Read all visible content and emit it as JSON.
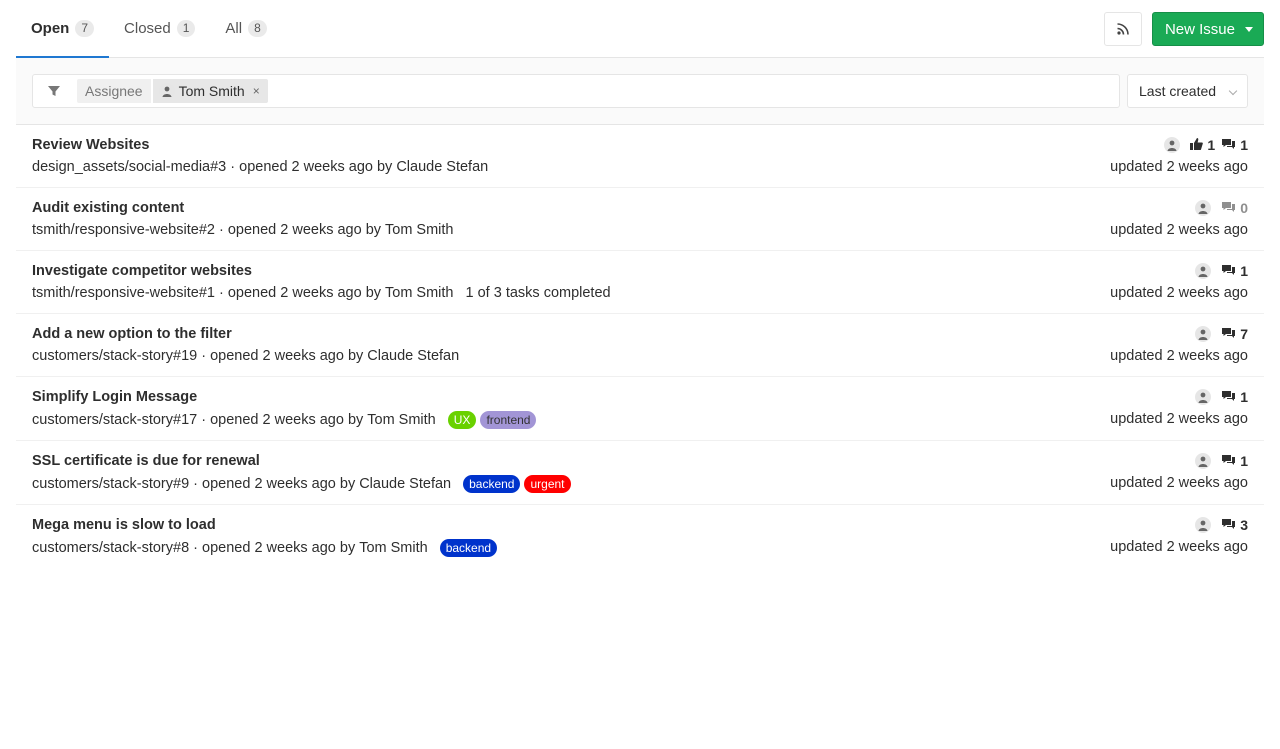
{
  "tabs": [
    {
      "label": "Open",
      "count": "7"
    },
    {
      "label": "Closed",
      "count": "1"
    },
    {
      "label": "All",
      "count": "8"
    }
  ],
  "actions": {
    "rss_icon": "rss-icon",
    "new_issue_label": "New Issue"
  },
  "filter": {
    "token_name": "Assignee",
    "token_value": "Tom Smith",
    "token_remove": "×"
  },
  "sort": {
    "selected": "Last created"
  },
  "colors": {
    "primary_green": "#1aaa55",
    "active_tab": "#1f78d1",
    "label_ux": "#69d100",
    "label_frontend": "#a295d6",
    "label_backend": "#0033cc",
    "label_urgent": "#ff0000"
  },
  "issues": [
    {
      "title": "Review Websites",
      "ref": "design_assets/social-media#3",
      "opened": " · opened 2 weeks ago by",
      "author": "Claude Stefan",
      "tasks": "",
      "labels": [],
      "thumbs_up": "1",
      "comments": "1",
      "updated": "updated 2 weeks ago"
    },
    {
      "title": "Audit existing content",
      "ref": "tsmith/responsive-website#2",
      "opened": " · opened 2 weeks ago by",
      "author": "Tom Smith",
      "tasks": "",
      "labels": [],
      "thumbs_up": "",
      "comments": "0",
      "updated": "updated 2 weeks ago"
    },
    {
      "title": "Investigate competitor websites",
      "ref": "tsmith/responsive-website#1",
      "opened": " · opened 2 weeks ago by",
      "author": "Tom Smith",
      "tasks": "1 of 3 tasks completed",
      "labels": [],
      "thumbs_up": "",
      "comments": "1",
      "updated": "updated 2 weeks ago"
    },
    {
      "title": "Add a new option to the filter",
      "ref": "customers/stack-story#19",
      "opened": " · opened 2 weeks ago by",
      "author": "Claude Stefan",
      "tasks": "",
      "labels": [],
      "thumbs_up": "",
      "comments": "7",
      "updated": "updated 2 weeks ago"
    },
    {
      "title": "Simplify Login Message",
      "ref": "customers/stack-story#17",
      "opened": " · opened 2 weeks ago by",
      "author": "Tom Smith",
      "tasks": "",
      "labels": [
        {
          "text": "UX",
          "color": "#69d100"
        },
        {
          "text": "frontend",
          "color": "#a295d6",
          "text_color": "#333333"
        }
      ],
      "thumbs_up": "",
      "comments": "1",
      "updated": "updated 2 weeks ago"
    },
    {
      "title": "SSL certificate is due for renewal",
      "ref": "customers/stack-story#9",
      "opened": " · opened 2 weeks ago by",
      "author": "Claude Stefan",
      "tasks": "",
      "labels": [
        {
          "text": "backend",
          "color": "#0033cc"
        },
        {
          "text": "urgent",
          "color": "#ff0000"
        }
      ],
      "thumbs_up": "",
      "comments": "1",
      "updated": "updated 2 weeks ago"
    },
    {
      "title": "Mega menu is slow to load",
      "ref": "customers/stack-story#8",
      "opened": " · opened 2 weeks ago by",
      "author": "Tom Smith",
      "tasks": "",
      "labels": [
        {
          "text": "backend",
          "color": "#0033cc"
        }
      ],
      "thumbs_up": "",
      "comments": "3",
      "updated": "updated 2 weeks ago"
    }
  ]
}
